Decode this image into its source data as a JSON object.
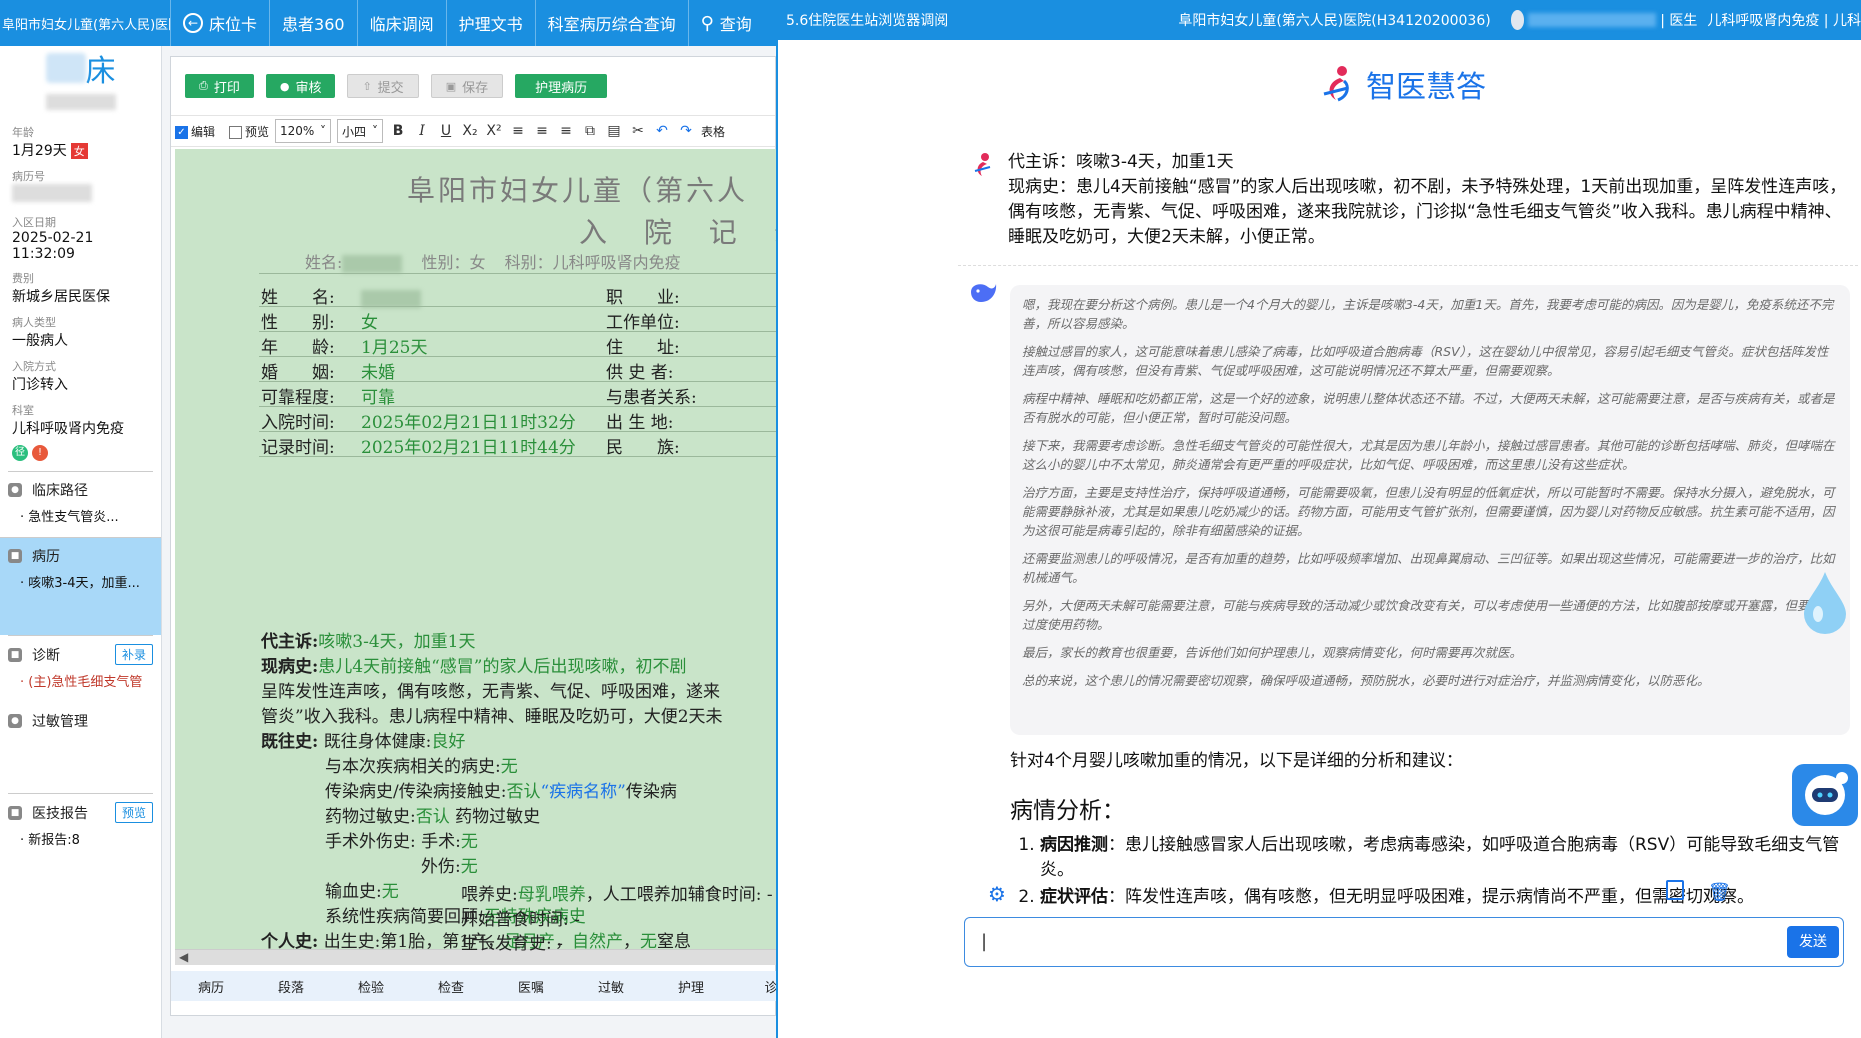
{
  "topnav": {
    "hospital": "阜阳市妇女儿童(第六人民)医院",
    "items": [
      {
        "icon": "back-circle-icon",
        "label": "床位卡"
      },
      {
        "label": "患者360"
      },
      {
        "label": "临床调阅"
      },
      {
        "label": "护理文书"
      },
      {
        "label": "科室病历综合查询"
      },
      {
        "icon": "search-icon",
        "label": "查询"
      }
    ]
  },
  "patient": {
    "bed_suffix": "床",
    "age_label": "年龄",
    "age": "1月29天",
    "gender": "女",
    "record_no_label": "病历号",
    "admit_date_label": "入区日期",
    "admit_date": "2025-02-21 11:32:09",
    "fee_type_label": "费别",
    "fee_type": "新城乡居民医保",
    "patient_type_label": "病人类型",
    "patient_type": "一般病人",
    "admit_way_label": "入院方式",
    "admit_way": "门诊转入",
    "dept_label": "科室",
    "dept": "儿科呼吸肾内免疫",
    "badge1": "径",
    "badge2": "!"
  },
  "sections": {
    "pathway": {
      "title": "临床路径",
      "sub": "· 急性支气管炎..."
    },
    "history": {
      "title": "病历",
      "sub": "· 咳嗽3-4天，加重..."
    },
    "diagnosis": {
      "title": "诊断",
      "btn": "补录",
      "sub": "· (主)急性毛细支气管"
    },
    "allergy": {
      "title": "过敏管理"
    },
    "report": {
      "title": "医技报告",
      "btn": "预览",
      "sub": "· 新报告:8"
    }
  },
  "editor": {
    "buttons": {
      "print": "打印",
      "review": "审核",
      "submit": "提交",
      "save": "保存",
      "nursing": "护理病历"
    },
    "edit_label": "编辑",
    "preview_label": "预览",
    "zoom": "120%",
    "font_size": "小四",
    "table_label": "表格",
    "bottom_tabs": [
      "病历",
      "段落",
      "检验",
      "检查",
      "医嘱",
      "过敏",
      "护理",
      "诊"
    ]
  },
  "doc": {
    "title1": "阜阳市妇女儿童（第六人",
    "title2": "入 院 记 录",
    "header": {
      "name_label": "姓名:",
      "gender_info": "性别：女",
      "dept_info": "科别：儿科呼吸肾内免疫"
    },
    "fields": [
      {
        "label": "姓　　名:",
        "value": "",
        "label2": "职　　业:"
      },
      {
        "label": "性　　别:",
        "value": "女",
        "label2": "工作单位:"
      },
      {
        "label": "年　　龄:",
        "value": "1月25天",
        "label2": "住　　址:"
      },
      {
        "label": "婚　　姻:",
        "value": "未婚",
        "label2": "供 史 者:"
      },
      {
        "label": "可靠程度:",
        "value": "可靠",
        "label2": "与患者关系:"
      },
      {
        "label": "入院时间:",
        "value": "2025年02月21日11时32分",
        "label2": "出 生 地:"
      },
      {
        "label": "记录时间:",
        "value": "2025年02月21日11时44分",
        "label2": "民　　族:"
      }
    ],
    "chief_label": "代主诉:",
    "chief": "咳嗽3-4天，加重1天",
    "present_label": "现病史:",
    "present1": "患儿4天前接触“感冒”的家人后出现咳嗽，初不剧",
    "present2": "呈阵发性连声咳，偶有咳憋，无青紫、气促、呼吸困难，遂来",
    "present3": "管炎”收入我科。患儿病程中精神、睡眠及吃奶可，大便2天未",
    "past_label": "既往史:",
    "past_health_label": "既往身体健康:",
    "past_health": "良好",
    "related_label": "与本次疾病相关的病史:",
    "related": "无",
    "infect_label": "传染病史/传染病接触史:",
    "infect_value": "否认",
    "infect_disease": "“疾病名称”",
    "infect_tail": "传染病",
    "drug_label": "药物过敏史:",
    "drug_value": "否认",
    "drug_tail": "药物过敏史",
    "surgery_label": "手术外伤史: 手术:",
    "surgery": "无",
    "trauma_label": "外伤:",
    "trauma": "无",
    "transfusion_label": "输血史:",
    "transfusion": "无",
    "system_label": "系统性疾病简要回顾:",
    "system": "无特殊疾病史",
    "personal_label": "个人史:",
    "birth_label": "出生史:第1胎，第1产，",
    "birth_v1": "足月产",
    "birth_v2": "自然产",
    "birth_v3": "无",
    "birth_tail": "窒息",
    "feed_label": "喂养史:",
    "feed_value": "母乳喂养",
    "feed_tail": "，人工喂养加辅食时间: -",
    "diet": "开始普食时间: -",
    "growth": "生长发育史: -"
  },
  "right": {
    "tab": "5.6住院医生站浏览器调阅",
    "hospital": "阜阳市妇女儿童(第六人民)医院(H34120200036)",
    "role": "| 医生",
    "dept": "儿科呼吸肾内免疫 | 儿科",
    "logo": "智医慧答",
    "user_msg1": "代主诉：咳嗽3-4天，加重1天",
    "user_msg2": "现病史：患儿4天前接触“感冒”的家人后出现咳嗽，初不剧，未予特殊处理，1天前出现加重，呈阵发性连声咳，偶有咳憋，无青紫、气促、呼吸困难，遂来我院就诊，门诊拟“急性毛细支气管炎”收入我科。患儿病程中精神、睡眠及吃奶可，大便2天未解，小便正常。",
    "thinking": [
      "嗯，我现在要分析这个病例。患儿是一个4个月大的婴儿，主诉是咳嗽3-4天，加重1天。首先，我要考虑可能的病因。因为是婴儿，免疫系统还不完善，所以容易感染。",
      "接触过感冒的家人，这可能意味着患儿感染了病毒，比如呼吸道合胞病毒（RSV），这在婴幼儿中很常见，容易引起毛细支气管炎。症状包括阵发性连声咳，偶有咳憋，但没有青紫、气促或呼吸困难，这可能说明情况还不算太严重，但需要观察。",
      "病程中精神、睡眠和吃奶都正常，这是一个好的迹象，说明患儿整体状态还不错。不过，大便两天未解，这可能需要注意，是否与疾病有关，或者是否有脱水的可能，但小便正常，暂时可能没问题。",
      "接下来，我需要考虑诊断。急性毛细支气管炎的可能性很大，尤其是因为患儿年龄小，接触过感冒患者。其他可能的诊断包括哮喘、肺炎，但哮喘在这么小的婴儿中不太常见，肺炎通常会有更严重的呼吸症状，比如气促、呼吸困难，而这里患儿没有这些症状。",
      "治疗方面，主要是支持性治疗，保持呼吸道通畅，可能需要吸氧，但患儿没有明显的低氧症状，所以可能暂时不需要。保持水分摄入，避免脱水，可能需要静脉补液，尤其是如果患儿吃奶减少的话。药物方面，可能用支气管扩张剂，但需要谨慎，因为婴儿对药物反应敏感。抗生素可能不适用，因为这很可能是病毒引起的，除非有细菌感染的证据。",
      "还需要监测患儿的呼吸情况，是否有加重的趋势，比如呼吸频率增加、出现鼻翼扇动、三凹征等。如果出现这些情况，可能需要进一步的治疗，比如机械通气。",
      "另外，大便两天未解可能需要注意，可能与疾病导致的活动减少或饮食改变有关，可以考虑使用一些通便的方法，比如腹部按摩或开塞露，但要避免过度使用药物。",
      "最后，家长的教育也很重要，告诉他们如何护理患儿，观察病情变化，何时需要再次就医。",
      "总的来说，这个患儿的情况需要密切观察，确保呼吸道通畅，预防脱水，必要时进行对症治疗，并监测病情变化，以防恶化。"
    ],
    "answer_intro": "针对4个月婴儿咳嗽加重的情况，以下是详细的分析和建议：",
    "answer_heading": "病情分析：",
    "answer_items": [
      {
        "bold": "病因推测",
        "text": "：患儿接触感冒家人后出现咳嗽，考虑病毒感染，如呼吸道合胞病毒（RSV）可能导致毛细支气管炎。"
      },
      {
        "bold": "症状评估",
        "text": "：阵发性连声咳，偶有咳憋，但无明显呼吸困难，提示病情尚不严重，但需密切观察。"
      }
    ],
    "input_value": "|",
    "send": "发送"
  },
  "colors": {
    "brand": "#1a8fe0",
    "doc_bg": "#c9e4c9",
    "green_btn": "#26a862"
  }
}
